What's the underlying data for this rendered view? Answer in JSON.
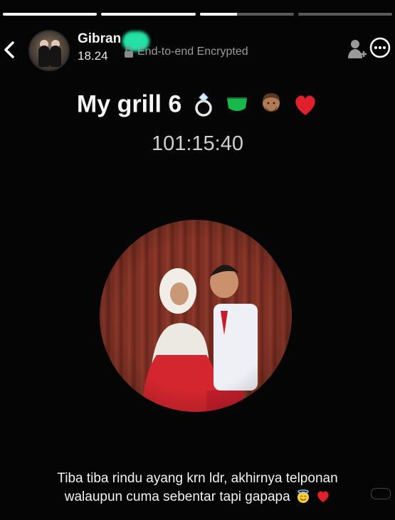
{
  "story_progress": [
    {
      "fill": 1
    },
    {
      "fill": 1
    },
    {
      "fill": 0.4
    },
    {
      "fill": 0
    }
  ],
  "header": {
    "contact_name": "Gibran",
    "time": "18.24",
    "encryption_label": "End-to-end Encrypted"
  },
  "call": {
    "title": "My grill 6",
    "title_emojis": [
      "ring",
      "green-heart",
      "person-beard",
      "red-heart"
    ],
    "duration": "101:15:40"
  },
  "caption": {
    "line1": "Tiba tiba rindu ayang krn ldr, akhirnya telponan",
    "line2": "walaupun cuma sebentar tapi gapapa",
    "emojis": [
      "smiling-face-with-halo",
      "red-heart"
    ]
  },
  "colors": {
    "background": "#050505",
    "accent_blob": "#24e0a5",
    "heart": "#e0202a"
  }
}
